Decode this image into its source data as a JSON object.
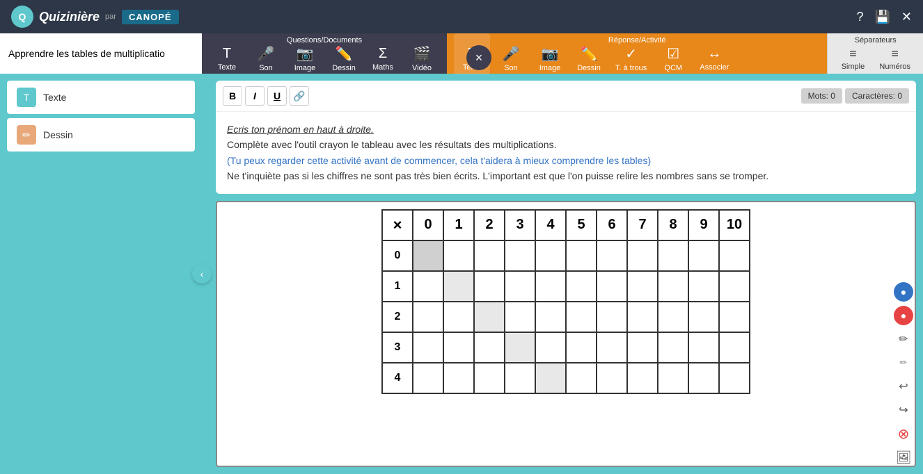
{
  "app": {
    "logo_text": "Quizinière",
    "logo_sub": "par",
    "canope_text": "CANOPÉ",
    "help_icon": "?",
    "save_icon": "💾",
    "close_icon": "✕"
  },
  "toolbar": {
    "questions_label": "Questions/Documents",
    "reponse_label": "Réponse/Activité",
    "separateurs_label": "Séparateurs",
    "close_btn": "×",
    "input_placeholder": "Apprendre les tables de multiplicatio",
    "questions_items": [
      {
        "label": "Texte",
        "icon": "T"
      },
      {
        "label": "Son",
        "icon": "🎤"
      },
      {
        "label": "Image",
        "icon": "📷"
      },
      {
        "label": "Dessin",
        "icon": "✏️"
      },
      {
        "label": "Maths",
        "icon": "Σ"
      },
      {
        "label": "Vidéo",
        "icon": "🎬"
      }
    ],
    "reponse_items": [
      {
        "label": "Texte",
        "icon": "T"
      },
      {
        "label": "Son",
        "icon": "🎤"
      },
      {
        "label": "Image",
        "icon": "📷"
      },
      {
        "label": "Dessin",
        "icon": "✏️"
      },
      {
        "label": "T. à trous",
        "icon": "✓"
      },
      {
        "label": "QCM",
        "icon": "☑"
      },
      {
        "label": "Associer",
        "icon": "↔"
      }
    ],
    "separateurs_items": [
      {
        "label": "Simple",
        "icon": "≡"
      },
      {
        "label": "Numéros",
        "icon": "≡#"
      }
    ]
  },
  "sidebar": {
    "items": [
      {
        "label": "Texte",
        "icon": "T",
        "type": "texte"
      },
      {
        "label": "Dessin",
        "icon": "✏",
        "type": "dessin"
      }
    ]
  },
  "editor": {
    "bold": "B",
    "italic": "I",
    "underline": "U",
    "link": "🔗",
    "words_label": "Mots: 0",
    "chars_label": "Caractères: 0",
    "line1": "Ecris ton prénom en haut à droite.",
    "line2": "Complète avec l'outil crayon le tableau avec les résultats des multiplications.",
    "line3": "(Tu peux regarder cette activité avant de commencer, cela t'aidera à mieux comprendre les tables)",
    "line4": "Ne t'inquiète pas si les chiffres ne sont pas très bien écrits. L'important est que l'on puisse relire les nombres sans se tromper."
  },
  "table": {
    "header": [
      "×",
      "0",
      "1",
      "2",
      "3",
      "4",
      "5",
      "6",
      "7",
      "8",
      "9",
      "10"
    ],
    "rows": [
      "0",
      "1",
      "2",
      "3",
      "4"
    ]
  },
  "drawing_tools": {
    "blue": "●",
    "red": "●",
    "pencil": "✏",
    "pencil2": "✏",
    "undo": "↩",
    "redo": "↪",
    "clear": "⊗",
    "image": "🖼"
  }
}
